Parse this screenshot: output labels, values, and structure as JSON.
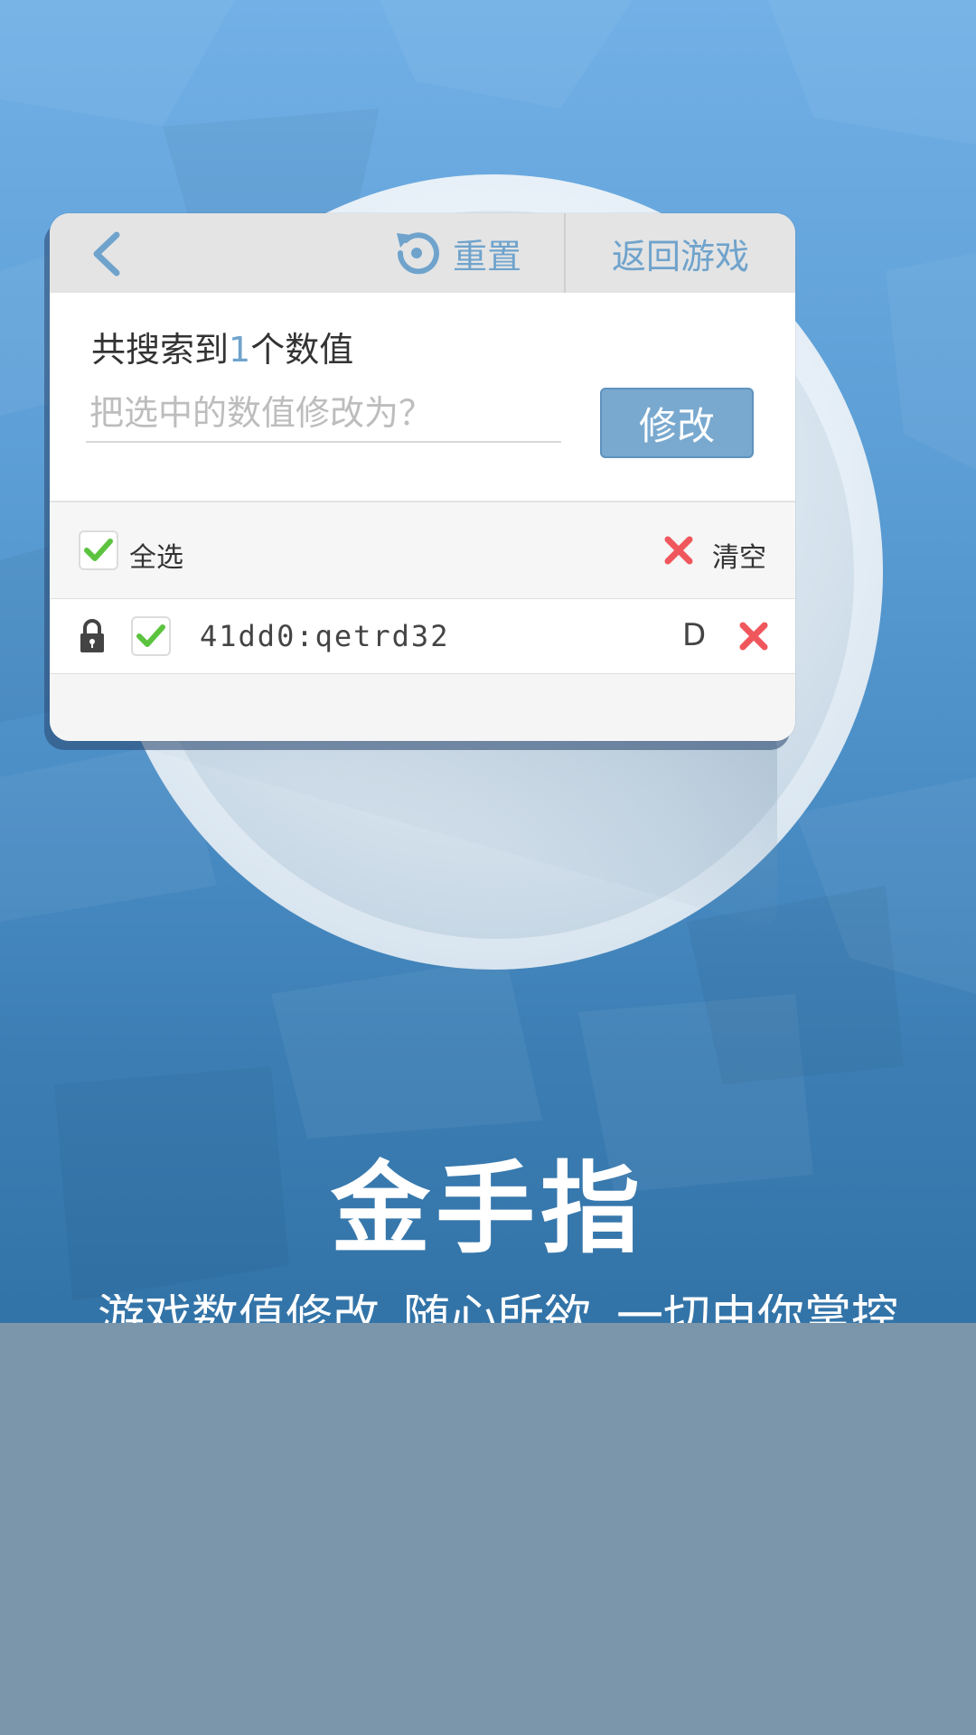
{
  "toolbar": {
    "reset_label": "重置",
    "return_label": "返回游戏"
  },
  "search": {
    "summary_prefix": "共搜索到",
    "count": "1",
    "summary_suffix": "个数值",
    "placeholder": "把选中的数值修改为？",
    "modify_label": "修改"
  },
  "list": {
    "select_all_label": "全选",
    "clear_label": "清空",
    "rows": [
      {
        "address": "41dd0:qetrd32",
        "type": "D"
      }
    ]
  },
  "app": {
    "title": "金手指",
    "tagline": [
      "游戏数值修改",
      "随心所欲",
      "一切由你掌控"
    ]
  },
  "colors": {
    "accent": "#6fa3cc",
    "check": "#5cc33f",
    "delete": "#f0575c",
    "bottom_band": "#7b96ab"
  }
}
